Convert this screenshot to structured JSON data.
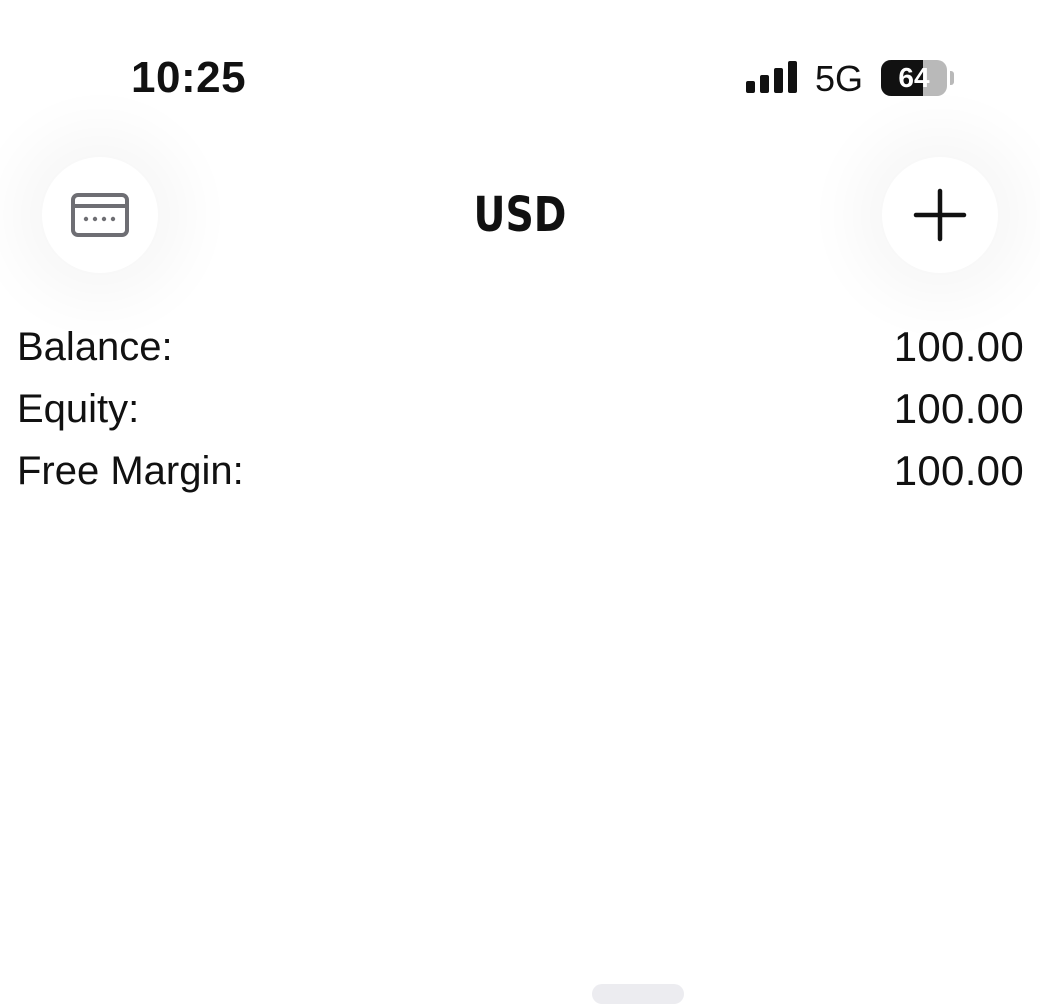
{
  "status_bar": {
    "time": "10:25",
    "network": "5G",
    "battery_level": "64",
    "battery_fraction": 0.64,
    "signal_icon": "cellular-signal-icon",
    "battery_icon": "battery-icon"
  },
  "header": {
    "title": "USD",
    "left_button_icon": "wallet-card-icon",
    "right_button_icon": "plus-icon"
  },
  "account": {
    "rows": [
      {
        "label": "Balance:",
        "value": "100.00"
      },
      {
        "label": "Equity:",
        "value": "100.00"
      },
      {
        "label": "Free Margin:",
        "value": "100.00"
      }
    ]
  },
  "colors": {
    "text": "#111111",
    "icon_gray": "#6e6e73",
    "background": "#ffffff",
    "battery_track": "#b9b9b9"
  }
}
